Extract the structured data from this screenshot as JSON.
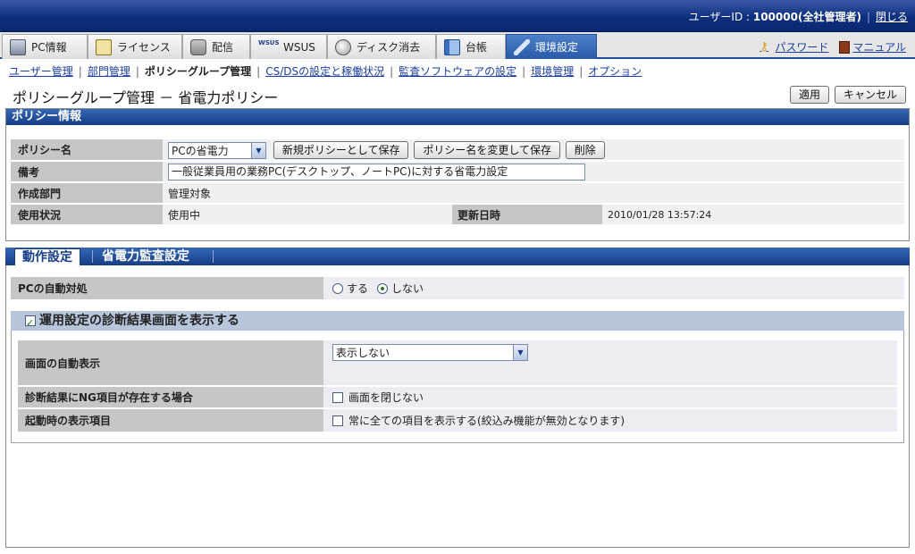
{
  "header": {
    "user_label": "ユーザーID : ",
    "user_value": "100000(全社管理者)",
    "close_link": "閉じる"
  },
  "tabs": [
    {
      "label": "PC情報",
      "icon": "pc-icon"
    },
    {
      "label": "ライセンス",
      "icon": "license-icon"
    },
    {
      "label": "配信",
      "icon": "distribution-icon"
    },
    {
      "label": "WSUS",
      "icon": "wsus-icon"
    },
    {
      "label": "ディスク消去",
      "icon": "disk-erase-icon"
    },
    {
      "label": "台帳",
      "icon": "ledger-icon"
    },
    {
      "label": "環境設定",
      "icon": "tools-icon",
      "active": true
    }
  ],
  "wsus_icon_text": "WSUS",
  "right_links": {
    "password": "パスワード",
    "manual": "マニュアル"
  },
  "submenu": {
    "items": [
      "ユーザー管理",
      "部門管理",
      "ポリシーグループ管理",
      "CS/DSの設定と稼働状況",
      "監査ソフトウェアの設定",
      "環境管理",
      "オプション"
    ],
    "current_index": 2
  },
  "page": {
    "title": "ポリシーグループ管理 － 省電力ポリシー",
    "apply_button": "適用",
    "cancel_button": "キャンセル"
  },
  "policy_info": {
    "section_title": "ポリシー情報",
    "name_label": "ポリシー名",
    "name_value": "PCの省電力",
    "save_new_button": "新規ポリシーとして保存",
    "rename_save_button": "ポリシー名を変更して保存",
    "delete_button": "削除",
    "note_label": "備考",
    "note_value": "一般従業員用の業務PC(デスクトップ、ノートPC)に対する省電力設定",
    "dept_label": "作成部門",
    "dept_value": "管理対象",
    "usage_label": "使用状況",
    "usage_value": "使用中",
    "updated_label": "更新日時",
    "updated_value": "2010/01/28 13:57:24"
  },
  "settings_tabs": {
    "active": "動作設定",
    "inactive": "省電力監査設定"
  },
  "operation": {
    "auto_label": "PCの自動対処",
    "option_yes": "する",
    "option_no": "しない",
    "selected": "しない",
    "group_title": "運用設定の診断結果画面を表示する",
    "group_checked": true,
    "screen_auto_label": "画面の自動表示",
    "screen_auto_value": "表示しない",
    "ng_label": "診断結果にNG項目が存在する場合",
    "ng_option": "画面を閉じない",
    "ng_checked": false,
    "startup_label": "起動時の表示項目",
    "startup_option": "常に全ての項目を表示する(絞込み機能が無効となります)",
    "startup_checked": false
  }
}
